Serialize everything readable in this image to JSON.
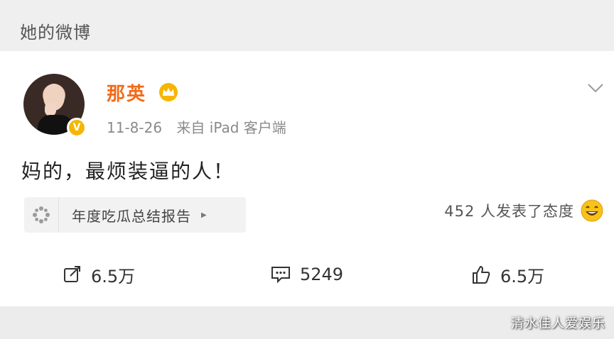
{
  "header": {
    "title": "她的微博"
  },
  "post": {
    "username": "那英",
    "date": "11-8-26",
    "source": "来自 iPad 客户端",
    "text": "妈的，最烦装逼的人！",
    "topic_label": "年度吃瓜总结报告",
    "attitude_text": "452 人发表了态度",
    "icons": {
      "crown": "crown-icon",
      "verified": "verified-badge-icon",
      "more": "chevron-down-icon",
      "topic": "flower-icon",
      "attitude": "smiley-icon",
      "repost": "repost-icon",
      "comment": "comment-icon",
      "like": "thumbs-up-icon"
    }
  },
  "actions": {
    "repost": "6.5万",
    "comment": "5249",
    "like": "6.5万"
  },
  "watermark": "清水佳人爱娱乐",
  "colors": {
    "username": "#f36a18",
    "badge": "#f6b600"
  }
}
